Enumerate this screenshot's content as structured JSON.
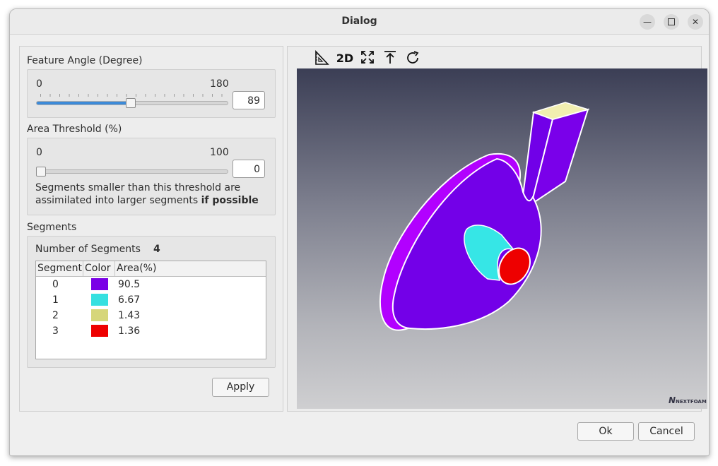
{
  "window": {
    "title": "Dialog"
  },
  "feature_angle": {
    "label": "Feature Angle (Degree)",
    "min": "0",
    "max": "180",
    "value": "89",
    "fraction": 0.494
  },
  "area_threshold": {
    "label": "Area Threshold (%)",
    "min": "0",
    "max": "100",
    "value": "0",
    "fraction": 0.0,
    "note": "Segments smaller than this threshold are",
    "note2": "assimilated into larger segments ",
    "note_bold": "if possible"
  },
  "segments": {
    "label": "Segments",
    "count_label": "Number of Segments",
    "count": "4",
    "columns": [
      "Segment",
      "Color",
      "Area(%)"
    ],
    "rows": [
      {
        "segment": "0",
        "color": "#7a00e6",
        "area": "90.5"
      },
      {
        "segment": "1",
        "color": "#36e0e0",
        "area": "6.67"
      },
      {
        "segment": "2",
        "color": "#d6d67a",
        "area": "1.43"
      },
      {
        "segment": "3",
        "color": "#ee0000",
        "area": "1.36"
      }
    ]
  },
  "buttons": {
    "apply": "Apply",
    "ok": "Ok",
    "cancel": "Cancel"
  },
  "toolbar": {
    "tools": [
      {
        "name": "measure-icon",
        "label": ""
      },
      {
        "name": "2d-view-button",
        "label": "2D"
      },
      {
        "name": "fit-view-icon",
        "label": ""
      },
      {
        "name": "align-top-icon",
        "label": ""
      },
      {
        "name": "reset-rotate-icon",
        "label": ""
      }
    ]
  },
  "logo": {
    "text": "NEXTFOAM"
  }
}
